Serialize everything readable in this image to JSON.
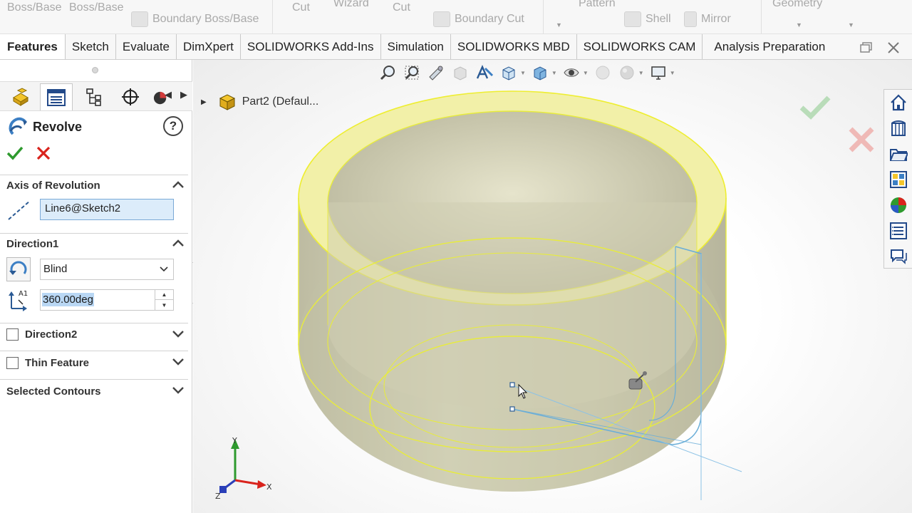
{
  "ribbon": {
    "items": [
      "Boss/Base",
      "Boss/Base",
      "Boundary Boss/Base",
      "Cut",
      "Wizard",
      "Cut",
      "Boundary Cut",
      "Pattern",
      "Shell",
      "Mirror",
      "Geometry"
    ]
  },
  "tabs": [
    "Features",
    "Sketch",
    "Evaluate",
    "DimXpert",
    "SOLIDWORKS Add-Ins",
    "Simulation",
    "SOLIDWORKS MBD",
    "SOLIDWORKS CAM",
    "Analysis Preparation"
  ],
  "property_manager": {
    "title": "Revolve",
    "help_label": "?",
    "sections": {
      "axis": {
        "header": "Axis of Revolution",
        "value": "Line6@Sketch2"
      },
      "direction1": {
        "header": "Direction1",
        "end_condition": "Blind",
        "angle": "360.00deg"
      },
      "direction2": {
        "header": "Direction2"
      },
      "thin_feature": {
        "header": "Thin Feature"
      },
      "selected_contours": {
        "header": "Selected Contours"
      }
    }
  },
  "viewport": {
    "tree_item": "Part2  (Defaul..."
  },
  "colors": {
    "accent_green": "#2e9a2e",
    "accent_red": "#d9231c",
    "model_yellow": "#e8ec3c",
    "sketch_blue": "#6aaed8"
  }
}
